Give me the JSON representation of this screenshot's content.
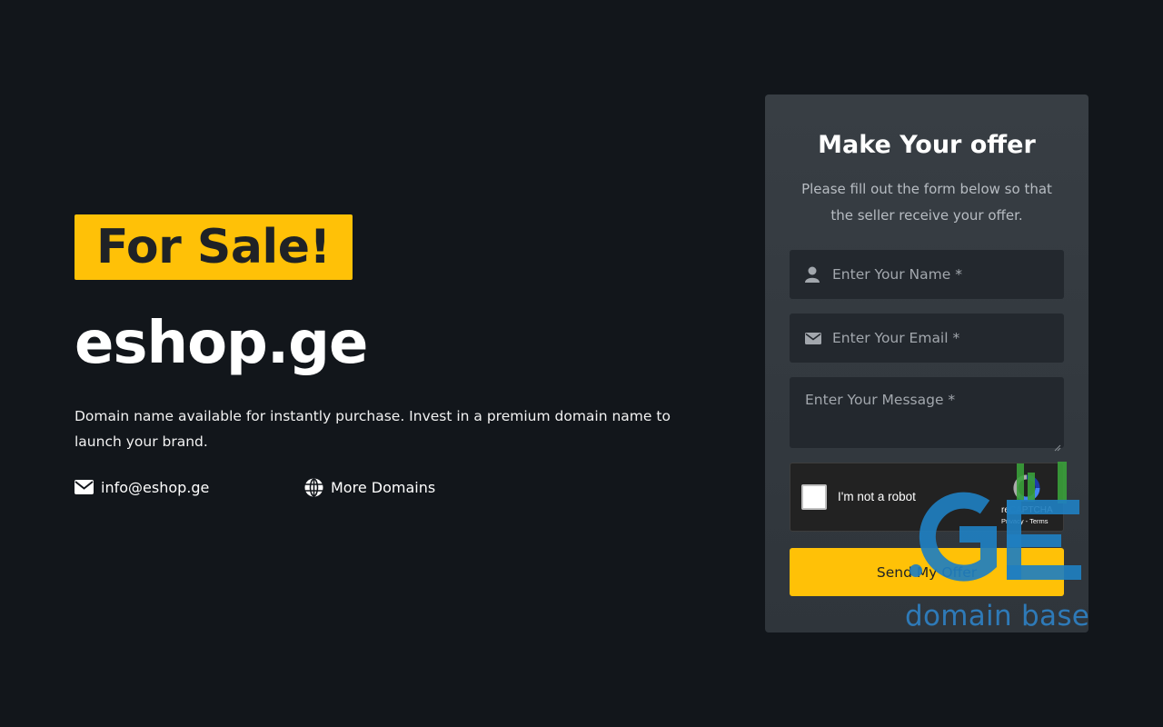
{
  "hero": {
    "badge": "For Sale!",
    "domain": "eshop.ge",
    "description": "Domain name available for instantly purchase. Invest in a premium domain name to launch your brand.",
    "email": "info@eshop.ge",
    "more_domains": "More Domains"
  },
  "form": {
    "title": "Make Your offer",
    "subtitle": "Please fill out the form below so that the seller receive your offer.",
    "name_placeholder": "Enter Your Name *",
    "email_placeholder": "Enter Your Email *",
    "message_placeholder": "Enter Your Message *",
    "captcha_label": "I'm not a robot",
    "captcha_brand": "reCAPTCHA",
    "captcha_terms": "Privacy - Terms",
    "submit_label": "Send My Offer"
  },
  "watermark": {
    "logo": "GE",
    "text": "domain base"
  },
  "colors": {
    "background": "#12161b",
    "accent": "#ffc107",
    "card": "#343a40",
    "input": "#23282e",
    "watermark": "#2e7ab8"
  },
  "icons": [
    "envelope-icon",
    "globe-icon",
    "user-icon",
    "recaptcha-icon"
  ]
}
